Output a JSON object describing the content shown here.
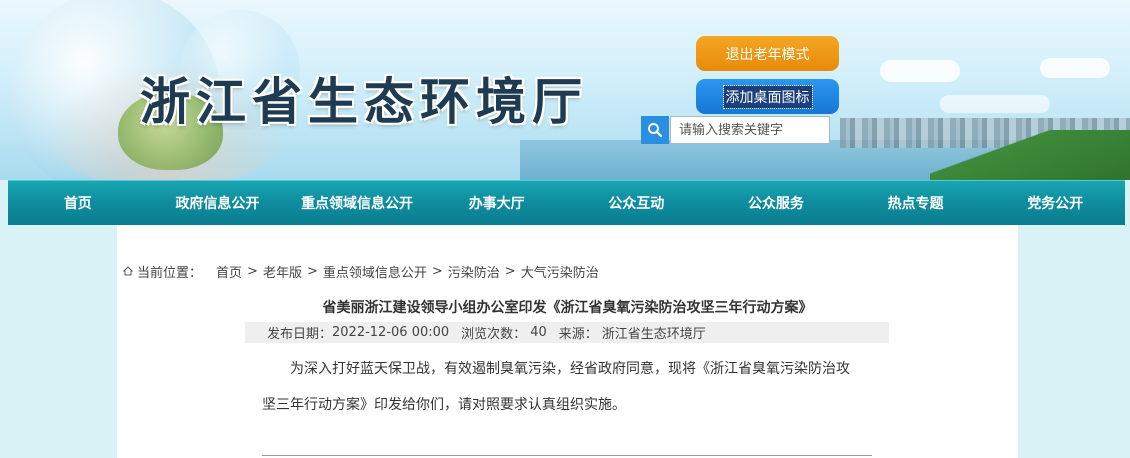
{
  "header": {
    "site_title": "浙江省生态环境厅",
    "exit_elder_mode": "退出老年模式",
    "add_desktop_icon": "添加桌面图标",
    "search_placeholder": "请输入搜索关键字",
    "search_icon": "search-icon"
  },
  "nav": {
    "items": [
      {
        "label": "首页"
      },
      {
        "label": "政府信息公开"
      },
      {
        "label": "重点领域信息公开"
      },
      {
        "label": "办事大厅"
      },
      {
        "label": "公众互动"
      },
      {
        "label": "公众服务"
      },
      {
        "label": "热点专题"
      },
      {
        "label": "党务公开"
      }
    ]
  },
  "breadcrumb": {
    "label": "当前位置：",
    "items": [
      "首页",
      "老年版",
      "重点领域信息公开",
      "污染防治",
      "大气污染防治"
    ],
    "separator": ">"
  },
  "article": {
    "title": "省美丽浙江建设领导小组办公室印发《浙江省臭氧污染防治攻坚三年行动方案》",
    "publish_label": "发布日期：",
    "publish_date": "2022-12-06 00:00",
    "views_label": "浏览次数：",
    "views": "40",
    "source_label": "来源：",
    "source": "浙江省生态环境厅",
    "paragraph_1": "为深入打好蓝天保卫战，有效遏制臭氧污染，经省政府同意，现将《浙江省臭氧污染防治攻",
    "paragraph_2": "坚三年行动方案》印发给你们，请对照要求认真组织实施。"
  },
  "colors": {
    "nav_bg": "#0f8ea0",
    "exit_button": "#f5a623",
    "add_button": "#2b97ef",
    "page_bg": "#d8f2f6"
  }
}
